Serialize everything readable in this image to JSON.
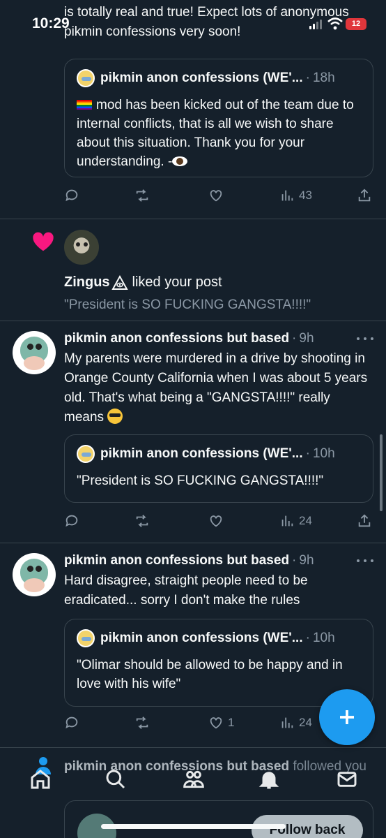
{
  "status_bar": {
    "time": "10:29",
    "battery": "12"
  },
  "previous_post": {
    "text": "is totally real and true! Expect lots of anonymous pikmin confessions very soon!",
    "quote": {
      "name": "pikmin anon confessions (WE'...",
      "time": "18h",
      "text": "mod has been kicked out of the team due to internal conflicts, that is all we wish to share about this situation. Thank you for your understanding. -"
    },
    "views": "43"
  },
  "like_notification": {
    "user": "Zingus",
    "action": "liked your post",
    "post_text": "\"President is SO FUCKING GANGSTA!!!!\"",
    "colors": {
      "heart": "#f91880"
    }
  },
  "tweets": [
    {
      "name": "pikmin anon confessions but based",
      "time": "9h",
      "text": "My parents were murdered in a drive by shooting in Orange County California when I was about 5 years old. That's what being a \"GANGSTA!!!!\" really means",
      "quote": {
        "name": "pikmin anon confessions (WE'...",
        "time": "10h",
        "text": "\"President is SO FUCKING GANGSTA!!!!\""
      },
      "views": "24"
    },
    {
      "name": "pikmin anon confessions but based",
      "time": "9h",
      "text": "Hard disagree, straight people need to be eradicated... sorry I don't make the rules",
      "quote": {
        "name": "pikmin anon confessions (WE'...",
        "time": "10h",
        "text": "\"Olimar should be allowed to be happy and in love with his wife\""
      },
      "likes": "1",
      "views": "24"
    }
  ],
  "follow_notification": {
    "user": "pikmin anon confessions but based",
    "action": "followed you",
    "button": "Follow back"
  },
  "icons": [
    "reply-icon",
    "retweet-icon",
    "like-icon",
    "views-icon",
    "share-icon",
    "compose-icon",
    "home-icon",
    "search-icon",
    "communities-icon",
    "notifications-icon",
    "messages-icon"
  ],
  "colors": {
    "background": "#15202b",
    "accent": "#1d9bf0",
    "muted": "#8b98a5",
    "border": "#38444d"
  }
}
